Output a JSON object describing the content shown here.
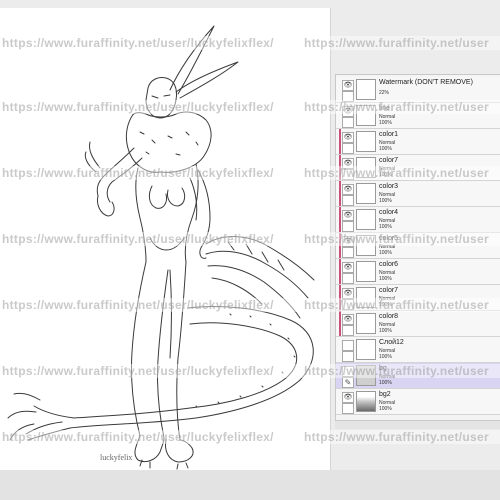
{
  "layers": [
    {
      "name": "Watermark (DON'T REMOVE)",
      "mode": "",
      "opacity": "22%",
      "visible": true
    },
    {
      "name": "line",
      "mode": "Normal",
      "opacity": "100%",
      "visible": true
    },
    {
      "name": "color1",
      "mode": "Normal",
      "opacity": "100%",
      "visible": true
    },
    {
      "name": "color7",
      "mode": "Normal",
      "opacity": "100%",
      "visible": true
    },
    {
      "name": "color3",
      "mode": "Normal",
      "opacity": "100%",
      "visible": true
    },
    {
      "name": "color4",
      "mode": "Normal",
      "opacity": "100%",
      "visible": true
    },
    {
      "name": "color5",
      "mode": "Normal",
      "opacity": "100%",
      "visible": true
    },
    {
      "name": "color6",
      "mode": "Normal",
      "opacity": "100%",
      "visible": true
    },
    {
      "name": "color7",
      "mode": "Normal",
      "opacity": "100%",
      "visible": true
    },
    {
      "name": "color8",
      "mode": "Normal",
      "opacity": "100%",
      "visible": true
    },
    {
      "name": "Слой12",
      "mode": "Normal",
      "opacity": "100%",
      "visible": false
    },
    {
      "name": "bg",
      "mode": "Normal",
      "opacity": "100%",
      "visible": false
    },
    {
      "name": "bg2",
      "mode": "Normal",
      "opacity": "100%",
      "visible": true
    }
  ],
  "watermark": {
    "text": "https://www.furaffinity.net/user/luckyfelixflex/",
    "text_right": "https://www.furaffinity.net/user"
  },
  "artwork": {
    "signature": "luckyfelix"
  },
  "colors": {
    "layer_group_marker": "#c95278",
    "selected_layer": "#d8d4f2",
    "panel_bg": "#f4f4f4"
  }
}
